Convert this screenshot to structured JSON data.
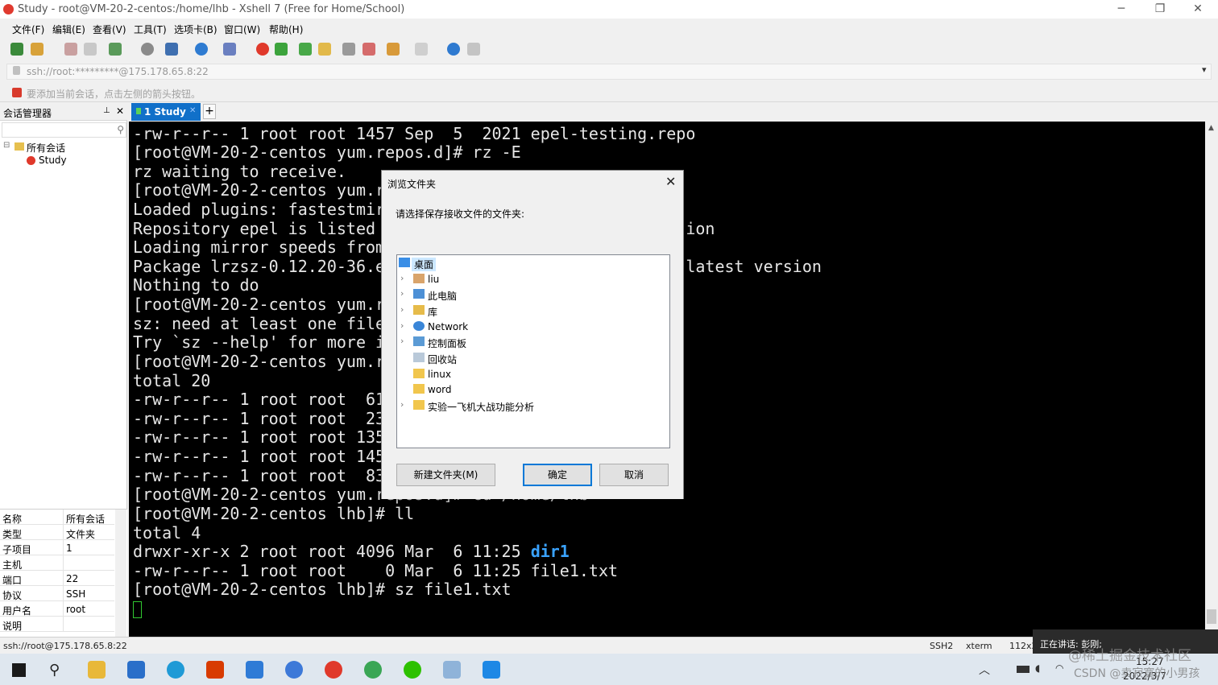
{
  "window": {
    "title": "Study - root@VM-20-2-centos:/home/lhb - Xshell 7 (Free for Home/School)",
    "minimize": "─",
    "restore": "❐",
    "close": "✕"
  },
  "menu": [
    "文件(F)",
    "编辑(E)",
    "查看(V)",
    "工具(T)",
    "选项卡(B)",
    "窗口(W)",
    "帮助(H)"
  ],
  "address": {
    "value": "ssh://root:*********@175.178.65.8:22",
    "dropdown": "▾"
  },
  "hint": "要添加当前会话，点击左侧的箭头按钮。",
  "sidebar": {
    "title": "会话管理器",
    "pin": "📌",
    "close": "✕",
    "tree": [
      {
        "label": "所有会话",
        "expander": "⊟"
      },
      {
        "label": "Study"
      }
    ],
    "props": [
      {
        "k": "名称",
        "v": "所有会话"
      },
      {
        "k": "类型",
        "v": "文件夹"
      },
      {
        "k": "子项目",
        "v": "1"
      },
      {
        "k": "主机",
        "v": ""
      },
      {
        "k": "端口",
        "v": "22"
      },
      {
        "k": "协议",
        "v": "SSH"
      },
      {
        "k": "用户名",
        "v": "root"
      },
      {
        "k": "说明",
        "v": ""
      }
    ]
  },
  "tabs": [
    {
      "label": "1 Study",
      "close": "✕"
    }
  ],
  "tab_add": "+",
  "terminal": {
    "lines": [
      "-rw-r--r-- 1 root root 1457 Sep  5  2021 epel-testing.repo",
      "[root@VM-20-2-centos yum.repos.d]# rz -E",
      "rz waiting to receive.",
      "[root@VM-20-2-centos yum.r",
      "Loaded plugins: fastestmir",
      "Repository epel is listed                                ion",
      "Loading mirror speeds from",
      "Package lrzsz-0.12.20-36.e                               latest version",
      "Nothing to do",
      "[root@VM-20-2-centos yum.r",
      "sz: need at least one file",
      "Try `sz --help' for more i",
      "[root@VM-20-2-centos yum.r",
      "total 20",
      "-rw-r--r-- 1 root root  61",
      "-rw-r--r-- 1 root root  23",
      "-rw-r--r-- 1 root root 135",
      "-rw-r--r-- 1 root root 145",
      "-rw-r--r-- 1 root root  83",
      "[root@VM-20-2-centos yum.repos.d]# cd /home/lhb",
      "[root@VM-20-2-centos lhb]# ll",
      "total 4",
      "drwxr-xr-x 2 root root 4096 Mar  6 11:25 ",
      "-rw-r--r-- 1 root root    0 Mar  6 11:25 file1.txt",
      "[root@VM-20-2-centos lhb]# sz file1.txt"
    ],
    "dir_name": "dir1",
    "dir_color": "#3aa3ff"
  },
  "dialog": {
    "title": "浏览文件夹",
    "close": "✕",
    "prompt": "请选择保存接收文件的文件夹:",
    "folders": [
      {
        "label": "桌面",
        "icon": "desktop-icon",
        "arrow": ""
      },
      {
        "label": "liu",
        "icon": "user-icon",
        "arrow": "›"
      },
      {
        "label": "此电脑",
        "icon": "computer-icon",
        "arrow": "›"
      },
      {
        "label": "库",
        "icon": "library-icon",
        "arrow": "›"
      },
      {
        "label": "Network",
        "icon": "network-icon",
        "arrow": "›"
      },
      {
        "label": "控制面板",
        "icon": "control-panel-icon",
        "arrow": "›"
      },
      {
        "label": "回收站",
        "icon": "recycle-bin-icon",
        "arrow": ""
      },
      {
        "label": "linux",
        "icon": "folder-icon",
        "arrow": ""
      },
      {
        "label": "word",
        "icon": "folder-icon",
        "arrow": ""
      },
      {
        "label": "实验一飞机大战功能分析",
        "icon": "folder-icon",
        "arrow": "›"
      }
    ],
    "new_folder": "新建文件夹(M)",
    "ok": "确定",
    "cancel": "取消"
  },
  "status": {
    "path": "ssh://root@175.178.65.8:22",
    "protocol": "SSH2",
    "term": "xterm",
    "size": "112x2"
  },
  "meeting": {
    "speaking": "正在讲话: 彭刚;"
  },
  "taskbar": {
    "time": "15:27",
    "date": "2022/3/7",
    "watermark": "@稀土掘金技术社区",
    "watermark2": "CSDN @卖寂寞的小男孩"
  }
}
